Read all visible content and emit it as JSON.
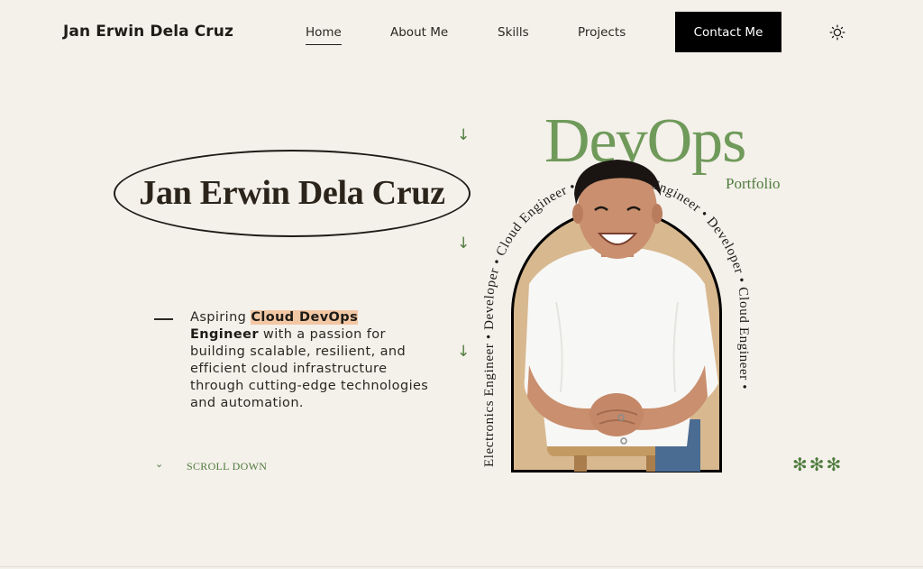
{
  "nav": {
    "brand": "Jan Erwin Dela Cruz",
    "links": [
      {
        "label": "Home",
        "active": true
      },
      {
        "label": "About Me",
        "active": false
      },
      {
        "label": "Skills",
        "active": false
      },
      {
        "label": "Projects",
        "active": false
      }
    ],
    "contact_label": "Contact Me",
    "theme_icon": "sun-icon"
  },
  "hero": {
    "name": "Jan Erwin Dela Cruz",
    "intro_prefix": "Aspiring ",
    "intro_highlight_1": "Cloud DevOps",
    "intro_highlight_2": "Engineer",
    "intro_suffix": " with a passion for building scalable, resilient, and efficient cloud infrastructure through cutting-edge technologies and automation.",
    "scroll_label": "SCROLL DOWN",
    "title_big": "DevOps",
    "title_small": "Portfolio",
    "ring_text": "Electronics Engineer • Developer • Cloud Engineer • Electronics Engineer • Developer • Cloud Engineer •",
    "asterisks": "✻✻✻",
    "arrow_glyph": "↓"
  },
  "colors": {
    "background": "#f4f0ea",
    "accent_green": "#4f7c3e",
    "highlight": "#f2c7a4",
    "button_bg": "#000000"
  }
}
